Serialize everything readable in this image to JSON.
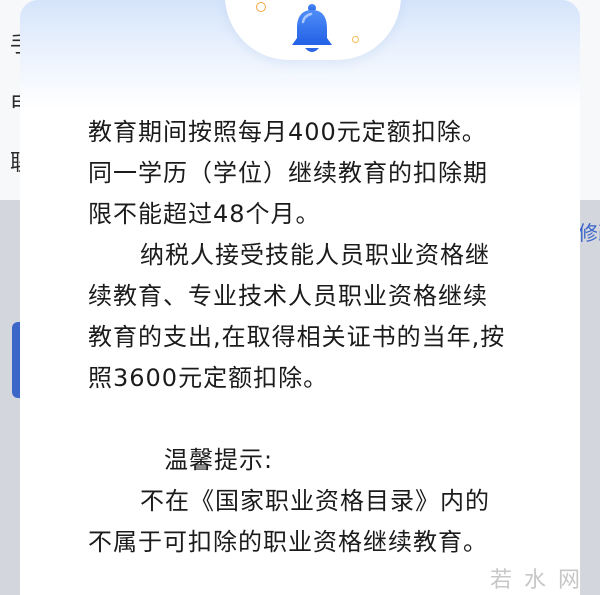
{
  "background": {
    "labels": [
      "手机",
      "电子",
      "联系"
    ],
    "link_fragment": "修改",
    "accent": "#3d66c9"
  },
  "dialog": {
    "icon": "bell-icon",
    "accent": "#2f6fe8",
    "paragraphs": [
      {
        "lines": [
          "教育期间按照每月400元定额扣除。",
          "同一学历（学位）继续教育的扣除期",
          "限不能超过48个月。"
        ]
      },
      {
        "lines": [
          "纳税人接受技能人员职业资格继",
          "续教育、专业技术人员职业资格继续",
          "教育的支出,在取得相关证书的当年,按",
          "照3600元定额扣除。"
        ]
      }
    ],
    "tip_title": "温馨提示:",
    "tip_lines": [
      "不在《国家职业资格目录》内的",
      "不属于可扣除的职业资格继续教育。"
    ]
  },
  "watermark": "若水网"
}
